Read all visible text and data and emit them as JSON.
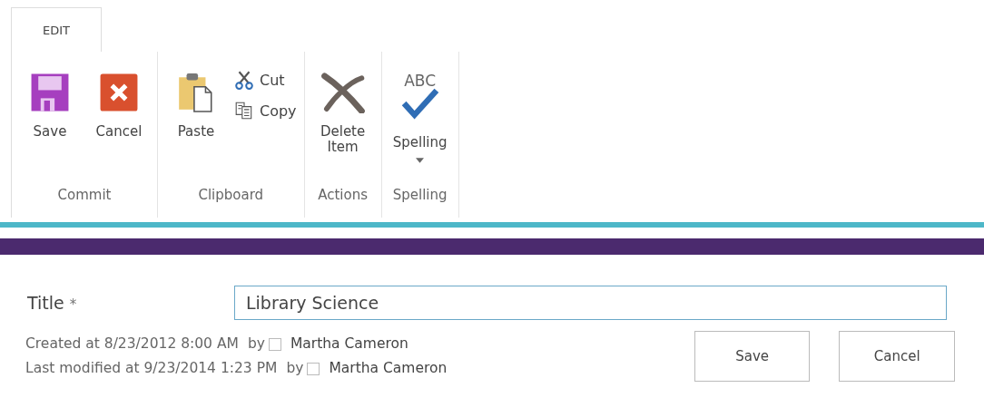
{
  "tabs": [
    {
      "label": "EDIT",
      "selected": true
    }
  ],
  "ribbon": {
    "groups": [
      {
        "label": "Commit",
        "items": [
          {
            "kind": "save",
            "label": "Save"
          },
          {
            "kind": "cancel",
            "label": "Cancel"
          }
        ]
      },
      {
        "label": "Clipboard",
        "items": [
          {
            "kind": "paste",
            "label": "Paste"
          },
          {
            "kind": "cut",
            "label": "Cut"
          },
          {
            "kind": "copy",
            "label": "Copy"
          }
        ]
      },
      {
        "label": "Actions",
        "items": [
          {
            "kind": "delete",
            "label": "Delete Item"
          }
        ]
      },
      {
        "label": "Spelling",
        "items": [
          {
            "kind": "spelling",
            "caption": "ABC",
            "label": "Spelling",
            "dropdown": true
          }
        ]
      }
    ]
  },
  "form": {
    "fields": [
      {
        "label": "Title",
        "required_mark": "*",
        "value": "Library Science"
      }
    ]
  },
  "footer": {
    "lines": [
      {
        "text": "Created at 8/23/2012 8:00 AM",
        "by": "by",
        "user": "Martha Cameron"
      },
      {
        "text": "Last modified at 9/23/2014 1:23 PM",
        "by": "by",
        "user": "Martha Cameron"
      }
    ],
    "buttons": [
      "Save",
      "Cancel"
    ]
  }
}
